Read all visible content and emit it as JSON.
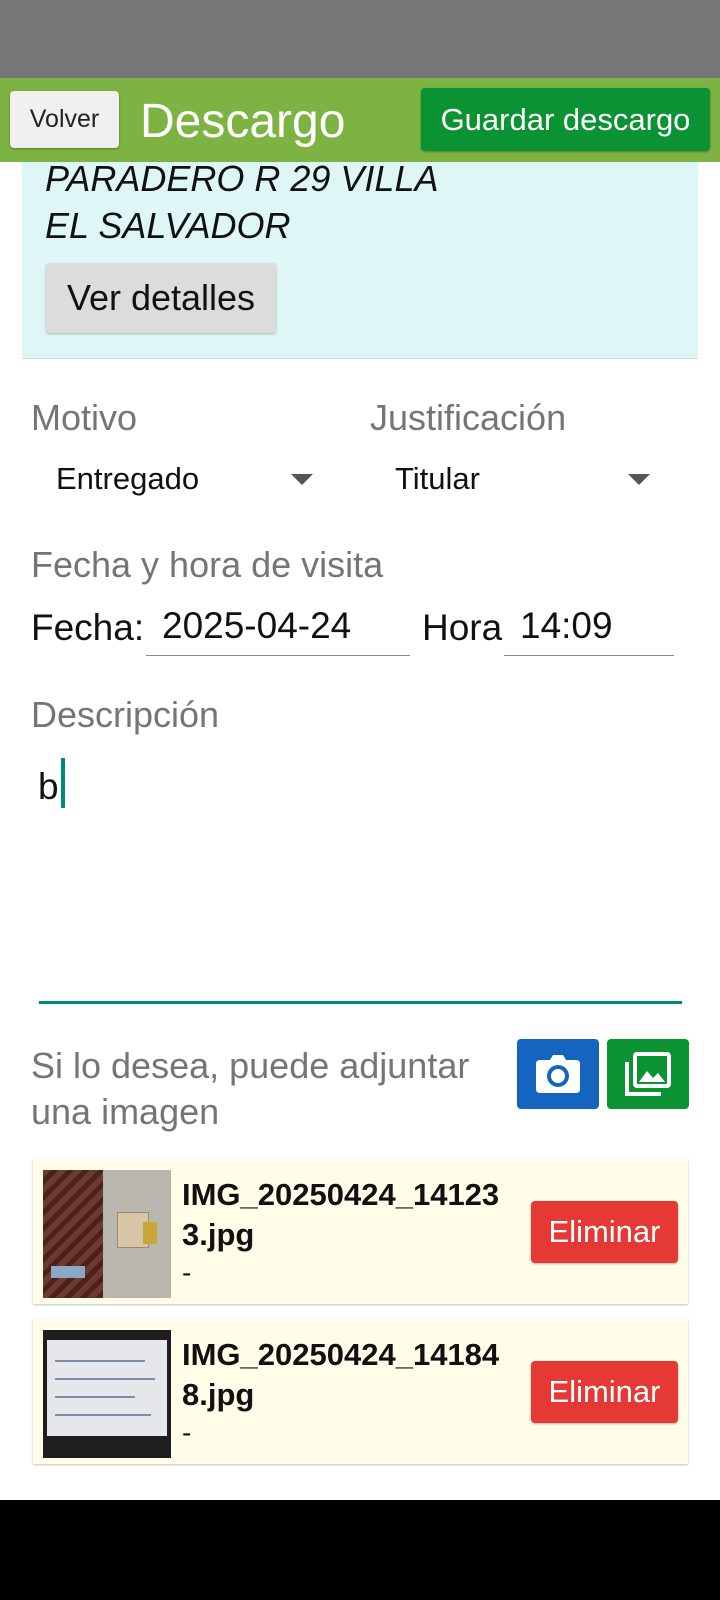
{
  "header": {
    "back_label": "Volver",
    "title": "Descargo",
    "save_label": "Guardar descargo",
    "accent_color": "#7cb342",
    "save_color": "#0a9233"
  },
  "address": {
    "line1": "PARADERO R 29 VILLA",
    "line2": "EL SALVADOR",
    "details_label": "Ver detalles"
  },
  "form": {
    "motivo_label": "Motivo",
    "motivo_value": "Entregado",
    "justificacion_label": "Justificación",
    "justificacion_value": "Titular",
    "visit_label": "Fecha y hora de visita",
    "fecha_label": "Fecha:",
    "fecha_value": "2025-04-24",
    "hora_label": "Hora",
    "hora_value": "14:09",
    "descripcion_label": "Descripción",
    "descripcion_value": "b"
  },
  "attachments": {
    "prompt": "Si lo desea, puede adjuntar una imagen",
    "camera_icon": "camera-icon",
    "gallery_icon": "image-gallery-icon",
    "items": [
      {
        "filename": "IMG_20250424_141233.jpg",
        "subtitle": "-",
        "delete_label": "Eliminar"
      },
      {
        "filename": "IMG_20250424_141848.jpg",
        "subtitle": "-",
        "delete_label": "Eliminar"
      }
    ]
  }
}
